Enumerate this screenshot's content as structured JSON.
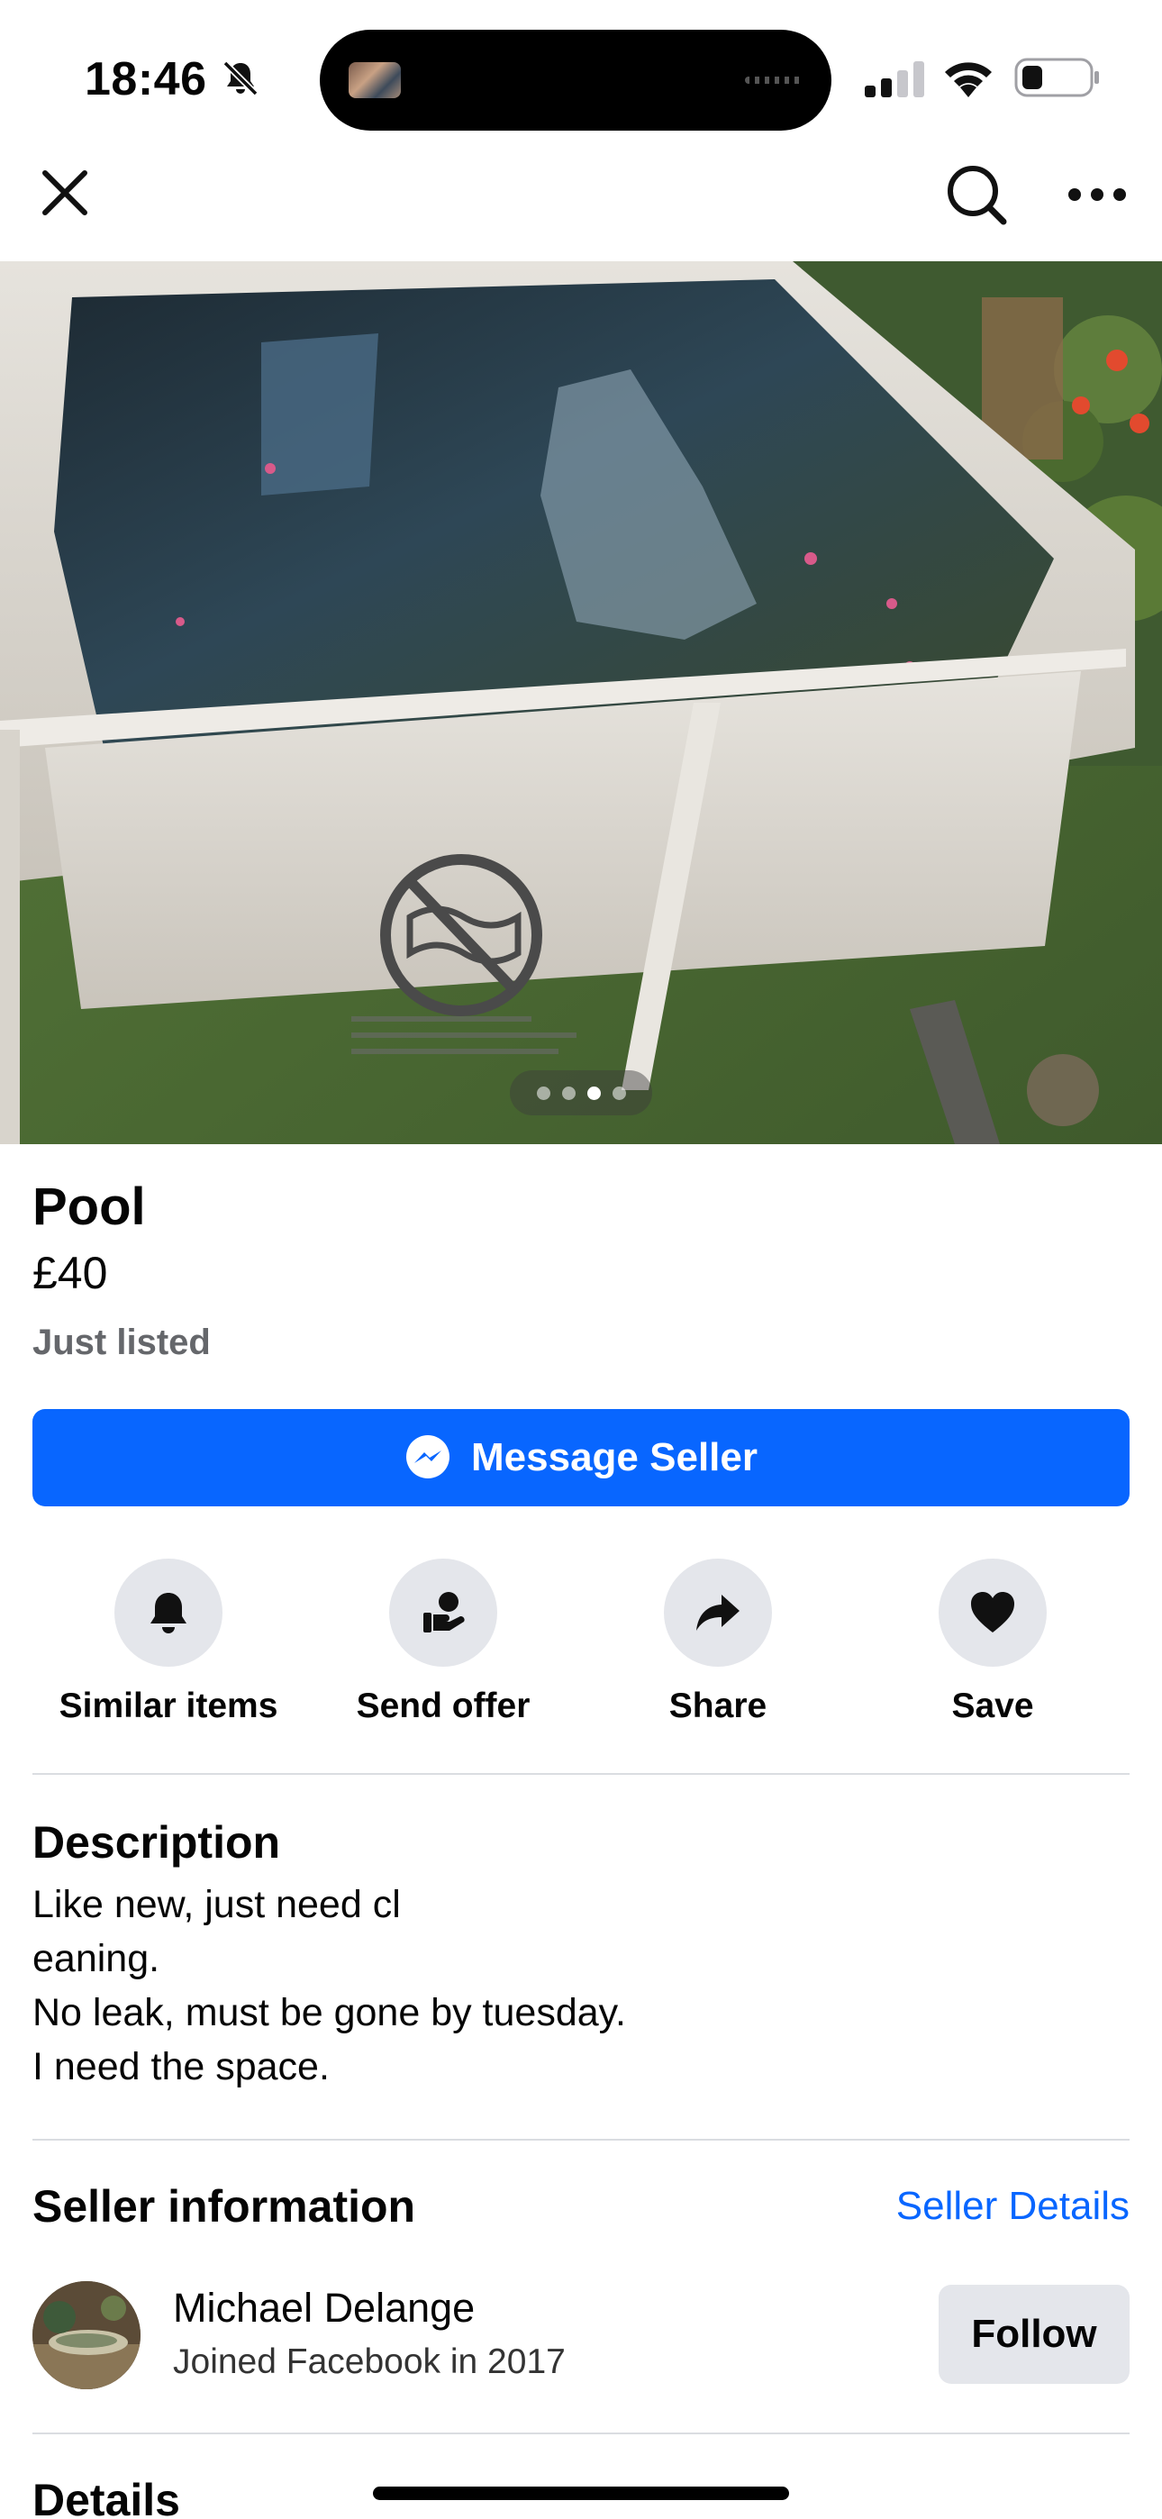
{
  "status_bar": {
    "time": "18:46",
    "icons": [
      "bell-slash-icon",
      "cellular-signal-icon",
      "wifi-icon",
      "battery-icon"
    ]
  },
  "nav": {
    "icons": [
      "close-icon",
      "search-icon",
      "more-icon"
    ]
  },
  "gallery": {
    "image_count": 4,
    "active_index": 2
  },
  "listing": {
    "title": "Pool",
    "price": "£40",
    "status": "Just listed",
    "message_button": "Message Seller"
  },
  "actions": [
    {
      "label": "Similar items",
      "icon": "bell-icon"
    },
    {
      "label": "Send offer",
      "icon": "offer-hand-icon"
    },
    {
      "label": "Share",
      "icon": "share-arrow-icon"
    },
    {
      "label": "Save",
      "icon": "heart-icon"
    }
  ],
  "description": {
    "heading": "Description",
    "text": "Like new, just need cl\neaning.\nNo leak, must be gone by tuesday.\nI need the space."
  },
  "seller": {
    "heading": "Seller information",
    "details_link": "Seller Details",
    "name": "Michael Delange",
    "joined": "Joined Facebook in 2017",
    "follow_button": "Follow"
  },
  "details": {
    "heading": "Details"
  },
  "colors": {
    "primary_blue": "#0866ff",
    "secondary_button": "#e4e6eb",
    "muted_text": "#65676b"
  }
}
